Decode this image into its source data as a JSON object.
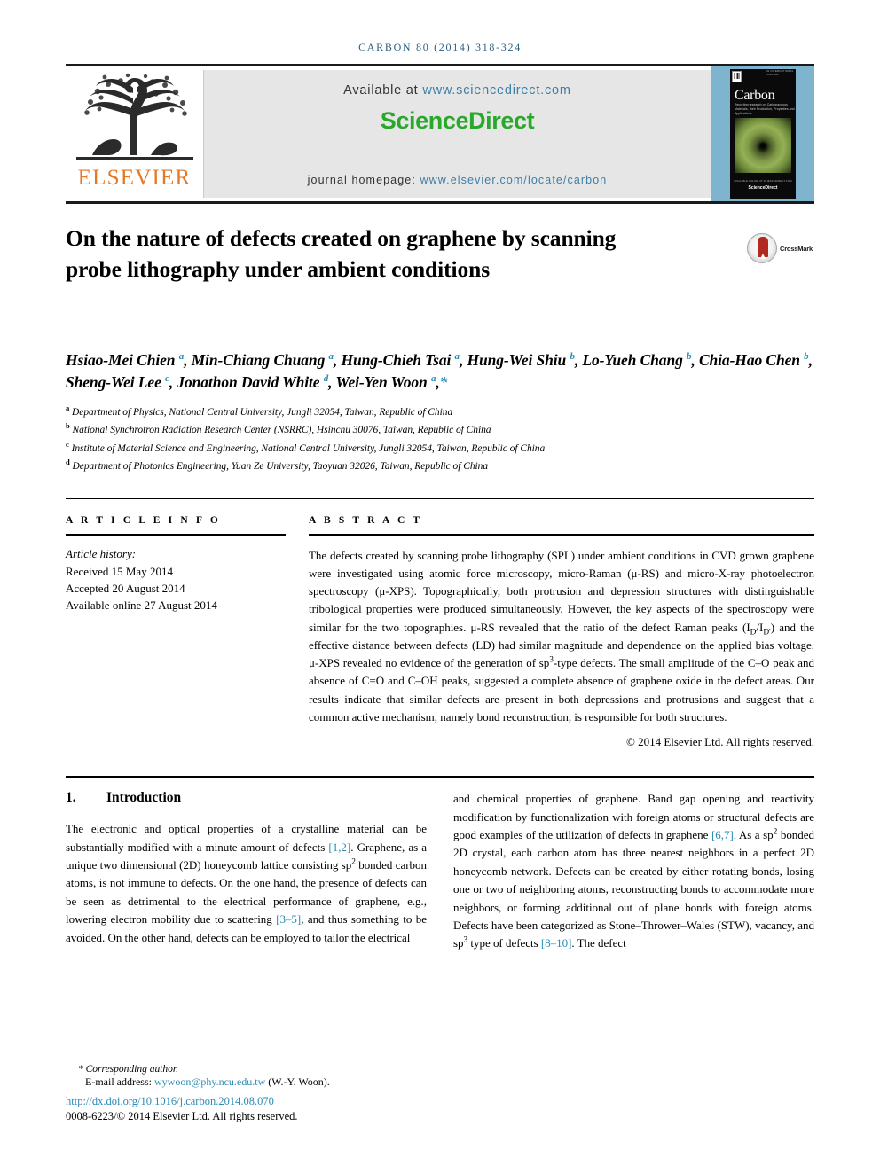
{
  "running_head": "CARBON 80 (2014) 318-324",
  "masthead": {
    "publisher_name": "ELSEVIER",
    "available_prefix": "Available at ",
    "available_url": "www.sciencedirect.com",
    "sciencedirect_logo": "ScienceDirect",
    "homepage_prefix": "journal homepage: ",
    "homepage_url": "www.elsevier.com/locate/carbon",
    "cover": {
      "journal_name": "Carbon",
      "kicker": "AN INTERNATIONAL JOURNAL",
      "subtitle": "Reporting research on Carbonaceous Materials, their Production, Properties and Applications",
      "footer_small": "AVAILABLE ONLINE AT SCIENCEDIRECT.COM",
      "footer_brand": "ScienceDirect"
    }
  },
  "article": {
    "title": "On the nature of defects created on graphene by scanning probe lithography under ambient conditions",
    "crossmark_label": "CrossMark",
    "authors_html": "Hsiao-Mei Chien <sup>a</sup>, Min-Chiang Chuang <sup>a</sup>, Hung-Chieh Tsai <sup>a</sup>, Hung-Wei Shiu <sup>b</sup>, Lo-Yueh Chang <sup>b</sup>, Chia-Hao Chen <sup>b</sup>, Sheng-Wei Lee <sup>c</sup>, Jonathon David White <sup>d</sup>, Wei-Yen Woon <sup>a</sup>,<span class=\"star\">*</span>",
    "affiliations": [
      {
        "marker": "a",
        "text": "Department of Physics, National Central University, Jungli 32054, Taiwan, Republic of China"
      },
      {
        "marker": "b",
        "text": "National Synchrotron Radiation Research Center (NSRRC), Hsinchu 30076, Taiwan, Republic of China"
      },
      {
        "marker": "c",
        "text": "Institute of Material Science and Engineering, National Central University, Jungli 32054, Taiwan, Republic of China"
      },
      {
        "marker": "d",
        "text": "Department of Photonics Engineering, Yuan Ze University, Taoyuan 32026, Taiwan, Republic of China"
      }
    ]
  },
  "article_info": {
    "heading": "A R T I C L E   I N F O",
    "history_label": "Article history:",
    "history": [
      "Received 15 May 2014",
      "Accepted 20 August 2014",
      "Available online 27 August 2014"
    ]
  },
  "abstract": {
    "heading": "A B S T R A C T",
    "text_html": "The defects created by scanning probe lithography (SPL) under ambient conditions in CVD grown graphene were investigated using atomic force microscopy, micro-Raman (&mu;-RS) and micro-X-ray photoelectron spectroscopy (&mu;-XPS). Topographically, both protrusion and depression structures with distinguishable tribological properties were produced simultaneously. However, the key aspects of the spectroscopy were similar for the two topographies. &mu;-RS revealed that the ratio of the defect Raman peaks (I<sub class=\"sub\">D</sub>/I<sub class=\"sub\">D'</sub>) and the effective distance between defects (LD) had similar magnitude and dependence on the applied bias voltage. &mu;-XPS revealed no evidence of the generation of sp<sup class=\"sup\">3</sup>-type defects. The small amplitude of the C&ndash;O peak and absence of C&#61;O and C&ndash;OH peaks, suggested a complete absence of graphene oxide in the defect areas. Our results indicate that similar defects are present in both depressions and protrusions and suggest that a common active mechanism, namely bond reconstruction, is responsible for both structures.",
    "copyright": "© 2014 Elsevier Ltd. All rights reserved."
  },
  "body": {
    "section_number": "1.",
    "section_title": "Introduction",
    "left_column_html": "The electronic and optical properties of a crystalline material can be substantially modified with a minute amount of defects <span class=\"ref\">[1,2]</span>. Graphene, as a unique two dimensional (2D) honeycomb lattice consisting sp<sup class=\"sup\">2</sup> bonded carbon atoms, is not immune to defects. On the one hand, the presence of defects can be seen as detrimental to the electrical performance of graphene, e.g., lowering electron mobility due to scattering <span class=\"ref\">[3&ndash;5]</span>, and thus something to be avoided. On the other hand, defects can be employed to tailor the electrical",
    "right_column_html": "and chemical properties of graphene. Band gap opening and reactivity modification by functionalization with foreign atoms or structural defects are good examples of the utilization of defects in graphene <span class=\"ref\">[6,7]</span>. As a sp<sup class=\"sup\">2</sup> bonded 2D crystal, each carbon atom has three nearest neighbors in a perfect 2D honeycomb network. Defects can be created by either rotating bonds, losing one or two of neighboring atoms, reconstructing bonds to accommodate more neighbors, or forming additional out of plane bonds with foreign atoms. Defects have been categorized as Stone&ndash;Thrower&ndash;Wales (STW), vacancy, and sp<sup class=\"sup\">3</sup> type of defects <span class=\"ref\">[8&ndash;10]</span>. The defect"
  },
  "footnote": {
    "corresponding": "* Corresponding author.",
    "email_label": "E-mail address: ",
    "email": "wywoon@phy.ncu.edu.tw",
    "email_suffix": " (W.-Y. Woon).",
    "doi": "http://dx.doi.org/10.1016/j.carbon.2014.08.070",
    "issn_line": "0008-6223/© 2014 Elsevier Ltd. All rights reserved."
  },
  "colors": {
    "link": "#2b8bb5",
    "elsevier_orange": "#E87722",
    "sciencedirect_green": "#2aa82a",
    "running_head": "#2b5f7e",
    "cover_blue": "#7fb4cf"
  }
}
